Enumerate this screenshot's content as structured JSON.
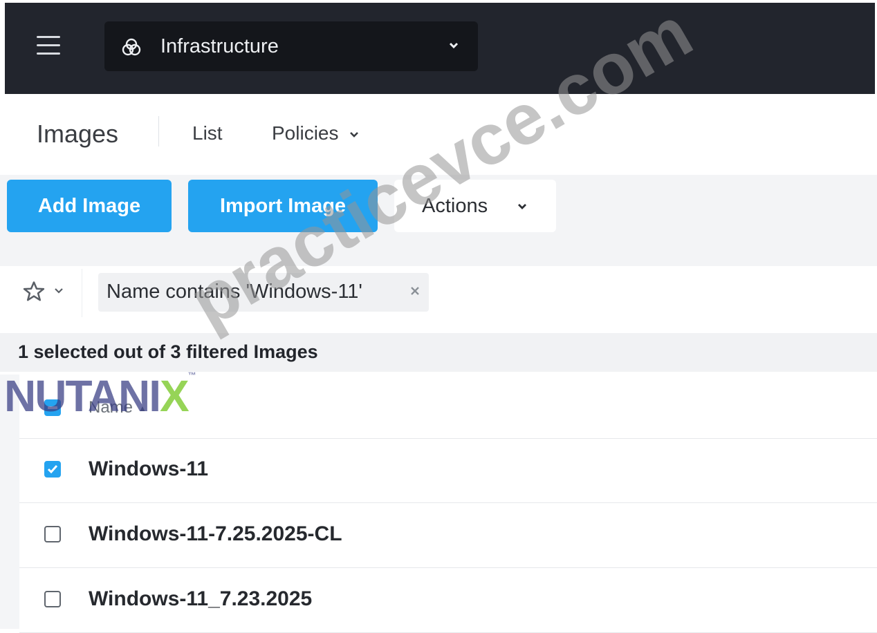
{
  "topbar": {
    "menu_icon": "hamburger-icon",
    "app_icon": "infrastructure-icon",
    "app_title": "Infrastructure",
    "dropdown_icon": "chevron-down-icon"
  },
  "subnav": {
    "title": "Images",
    "tabs": [
      {
        "label": "List"
      },
      {
        "label": "Policies"
      }
    ]
  },
  "toolbar": {
    "add_label": "Add Image",
    "import_label": "Import Image",
    "actions_label": "Actions"
  },
  "filter": {
    "favorites_icon": "star-icon",
    "chip_text": "Name contains 'Windows-11'",
    "chip_close_icon": "close-icon"
  },
  "selection": {
    "summary": "1 selected out of 3 filtered Images"
  },
  "table": {
    "columns": [
      {
        "label": "Name",
        "sort": "ascending"
      }
    ],
    "rows": [
      {
        "name": "Windows-11",
        "checked": true
      },
      {
        "name": "Windows-11-7.25.2025-CL",
        "checked": false
      },
      {
        "name": "Windows-11_7.23.2025",
        "checked": false
      }
    ]
  },
  "watermarks": {
    "logo": "NUTANIX",
    "site": "practicevce.com"
  },
  "colors": {
    "topbar": "#22252d",
    "primary": "#24a3f0",
    "accent_logo": "#78c828"
  }
}
